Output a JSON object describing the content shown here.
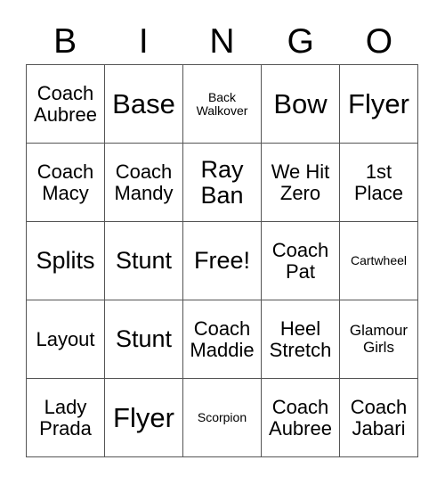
{
  "header": {
    "letters": [
      "B",
      "I",
      "N",
      "G",
      "O"
    ]
  },
  "grid": {
    "rows": [
      [
        {
          "label": "Coach Aubree",
          "size": "md"
        },
        {
          "label": "Base",
          "size": "xl"
        },
        {
          "label": "Back Walkover",
          "size": "xs"
        },
        {
          "label": "Bow",
          "size": "xl"
        },
        {
          "label": "Flyer",
          "size": "xl"
        }
      ],
      [
        {
          "label": "Coach Macy",
          "size": "md"
        },
        {
          "label": "Coach Mandy",
          "size": "md"
        },
        {
          "label": "Ray Ban",
          "size": "lg"
        },
        {
          "label": "We Hit Zero",
          "size": "md"
        },
        {
          "label": "1st Place",
          "size": "md"
        }
      ],
      [
        {
          "label": "Splits",
          "size": "lg"
        },
        {
          "label": "Stunt",
          "size": "lg"
        },
        {
          "label": "Free!",
          "size": "lg"
        },
        {
          "label": "Coach Pat",
          "size": "md"
        },
        {
          "label": "Cartwheel",
          "size": "xs"
        }
      ],
      [
        {
          "label": "Layout",
          "size": "md"
        },
        {
          "label": "Stunt",
          "size": "lg"
        },
        {
          "label": "Coach Maddie",
          "size": "md"
        },
        {
          "label": "Heel Stretch",
          "size": "md"
        },
        {
          "label": "Glamour Girls",
          "size": "sm"
        }
      ],
      [
        {
          "label": "Lady Prada",
          "size": "md"
        },
        {
          "label": "Flyer",
          "size": "xl"
        },
        {
          "label": "Scorpion",
          "size": "xs"
        },
        {
          "label": "Coach Aubree",
          "size": "md"
        },
        {
          "label": "Coach Jabari",
          "size": "md"
        }
      ]
    ]
  },
  "colors": {
    "border": "#555555",
    "text": "#000000",
    "background": "#ffffff"
  }
}
